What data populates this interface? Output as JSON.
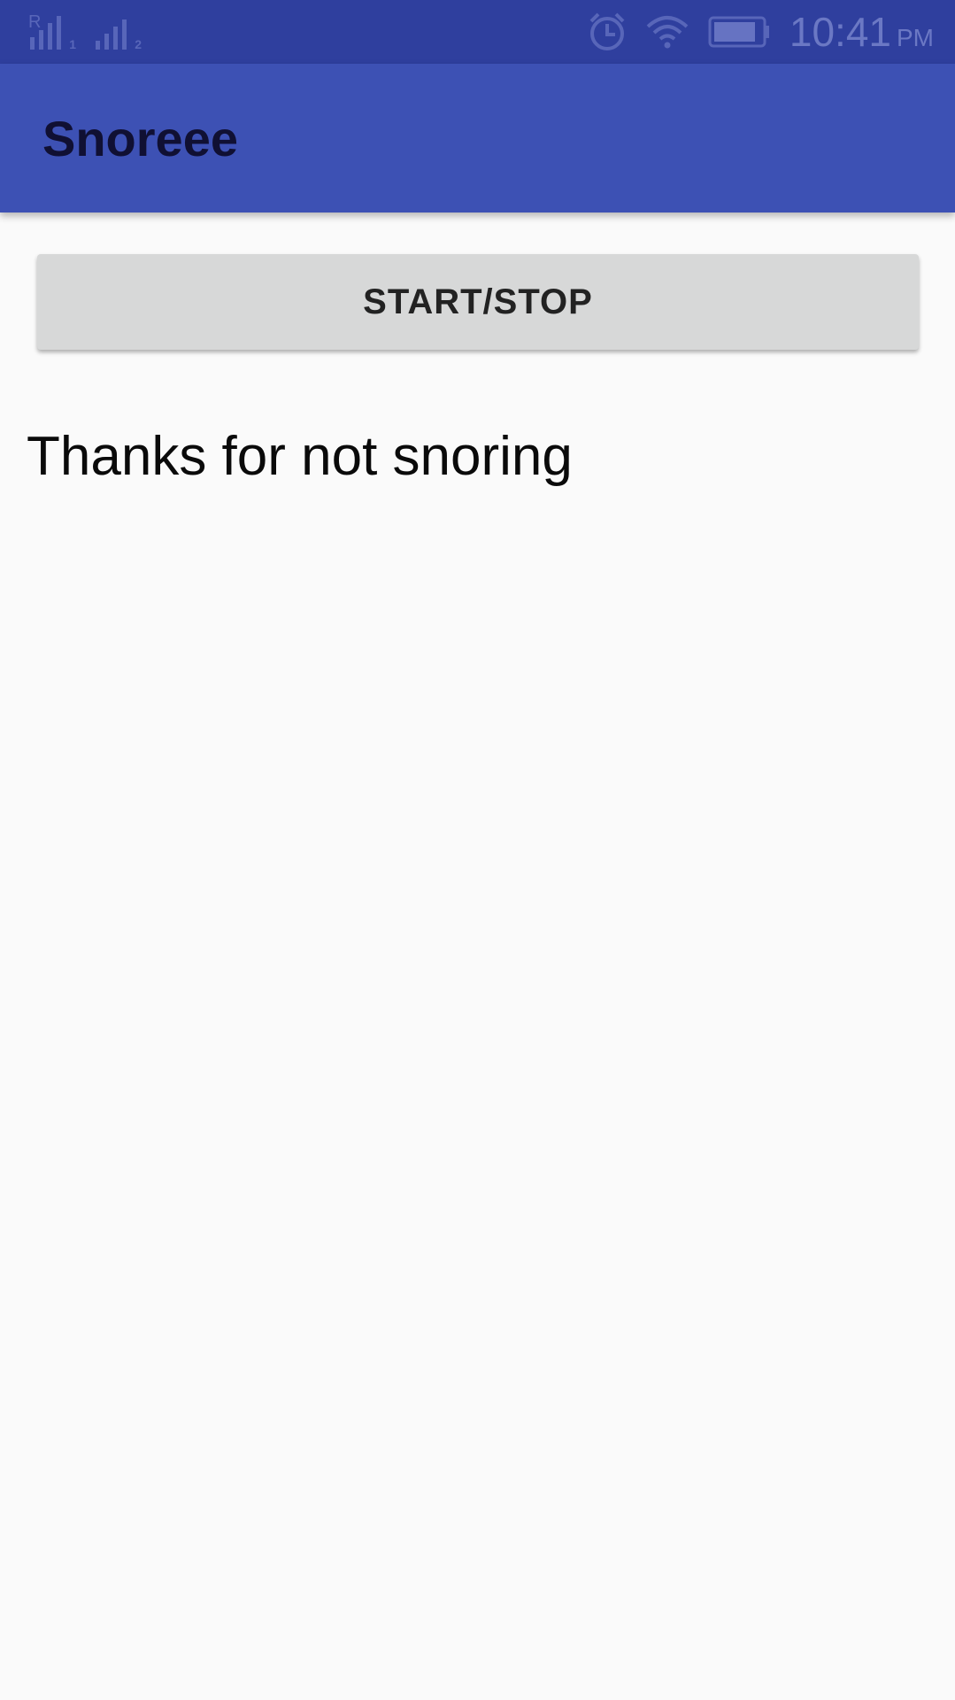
{
  "status_bar": {
    "sim1_index": "1",
    "sim2_index": "2",
    "roaming_indicator": "R",
    "time": "10:41",
    "ampm": "PM",
    "icons": [
      "signal-icon",
      "alarm-icon",
      "wifi-icon",
      "battery-icon"
    ],
    "color": "#2f3f9e"
  },
  "app_bar": {
    "title": "Snoreee",
    "color": "#3d51b4"
  },
  "main": {
    "button_label": "START/STOP",
    "message": "Thanks for not snoring"
  }
}
